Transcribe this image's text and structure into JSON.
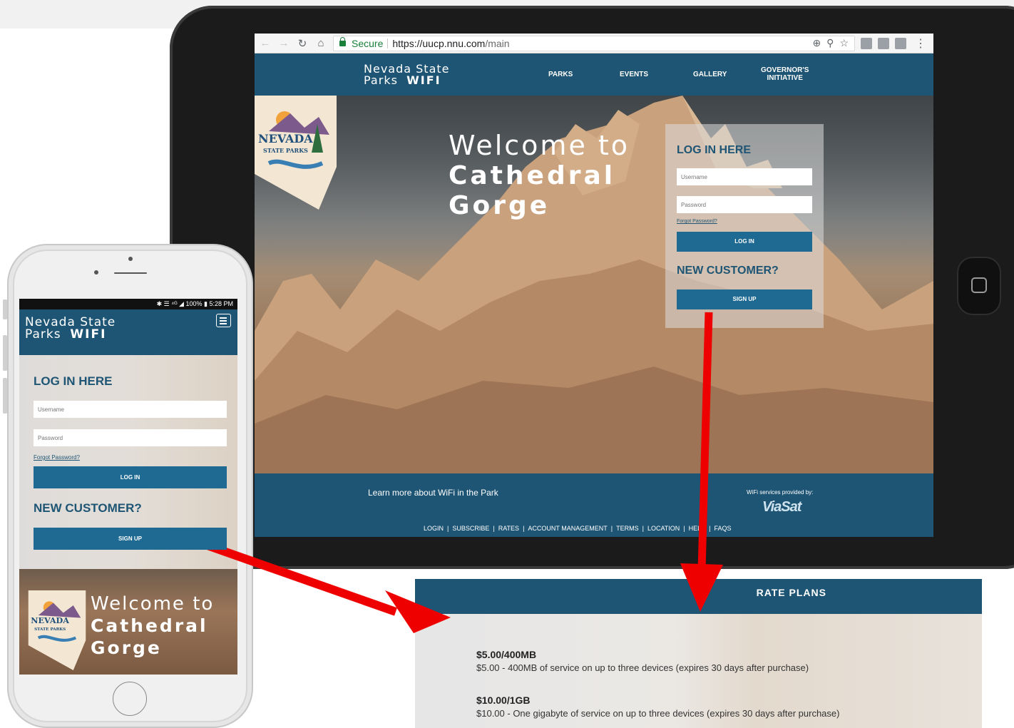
{
  "browser": {
    "secure_label": "Secure",
    "url_host": "https://uucp.nnu.com",
    "url_path": "/main"
  },
  "site": {
    "logo_line1": "Nevada State",
    "logo_line2_a": "Parks",
    "logo_line2_b": "WIFI",
    "menu": {
      "parks": "PARKS",
      "events": "EVENTS",
      "gallery": "GALLERY",
      "governor_line1": "GOVERNOR'S",
      "governor_line2": "INITIATIVE"
    },
    "welcome_line1": "Welcome to",
    "welcome_line2": "Cathedral",
    "welcome_line3": "Gorge",
    "badge_text1": "NEVADA",
    "badge_text2": "STATE PARKS"
  },
  "login": {
    "title": "LOG IN HERE",
    "username_placeholder": "Username",
    "password_placeholder": "Password",
    "forgot": "Forgot Password?",
    "login_button": "LOG IN",
    "new_customer": "NEW CUSTOMER?",
    "signup_button": "SIGN UP"
  },
  "footer": {
    "learn_more": "Learn more about WiFi in the Park",
    "provided_by": "WiFi services provided by:",
    "provider": "ViaSat",
    "links": [
      "LOGIN",
      "SUBSCRIBE",
      "RATES",
      "ACCOUNT MANAGEMENT",
      "TERMS",
      "LOCATION",
      "HELP",
      "FAQS"
    ]
  },
  "phone": {
    "status_text": "100% ▮ 5:28 PM",
    "status_icons": "✱ ☰ ⁴ᴳ ◢"
  },
  "rates": {
    "title": "RATE PLANS",
    "plans": [
      {
        "name": "$5.00/400MB",
        "desc": "$5.00 - 400MB of service on up to three devices (expires 30 days after purchase)"
      },
      {
        "name": "$10.00/1GB",
        "desc": "$10.00 - One gigabyte of service on up to three devices (expires 30 days after purchase)"
      }
    ]
  },
  "colors": {
    "brand_blue": "#1e5574",
    "button_blue": "#1e6a93",
    "arrow_red": "#ee0000"
  }
}
